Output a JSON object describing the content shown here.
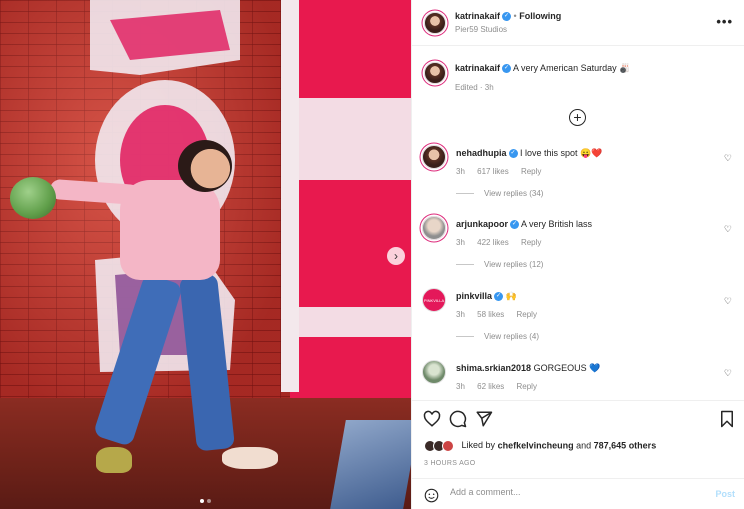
{
  "post": {
    "header": {
      "username": "katrinakaif",
      "separator": "•",
      "follow_label": "Following",
      "location": "Pier59 Studios",
      "more_label": "•••"
    },
    "caption": {
      "username": "katrinakaif",
      "text": "A very American Saturday 🎳",
      "meta": "Edited · 3h"
    },
    "load_more_label": "+",
    "next_label": "›",
    "carousel": {
      "count": 2,
      "active_index": 0
    }
  },
  "comments": [
    {
      "username": "nehadhupia",
      "verified": true,
      "text": "I love this spot 😛❤️",
      "time": "3h",
      "likes": "617 likes",
      "reply": "Reply",
      "replies": "View replies (34)"
    },
    {
      "username": "arjunkapoor",
      "verified": true,
      "text": "A very British lass",
      "time": "3h",
      "likes": "422 likes",
      "reply": "Reply",
      "replies": "View replies (12)"
    },
    {
      "username": "pinkvilla",
      "verified": true,
      "text": "🙌",
      "time": "3h",
      "likes": "58 likes",
      "reply": "Reply",
      "replies": "View replies (4)",
      "avatar_text": "PINKVILLA"
    },
    {
      "username": "shima.srkian2018",
      "verified": false,
      "text": "GORGEOUS 💙",
      "time": "3h",
      "likes": "62 likes",
      "reply": "Reply",
      "replies": ""
    }
  ],
  "actions": {
    "like_icon": "heart-icon",
    "comment_icon": "comment-icon",
    "share_icon": "share-icon",
    "save_icon": "bookmark-icon"
  },
  "likes": {
    "prefix": "Liked by",
    "user": "chefkelvincheung",
    "middle": "and",
    "others": "787,645 others"
  },
  "timestamp": "3 HOURS AGO",
  "add_comment": {
    "placeholder": "Add a comment...",
    "post_label": "Post"
  },
  "colors": {
    "verified": "#3897f0",
    "post_disabled": "#b2dffc",
    "text": "#262626",
    "muted": "#8e8e8e"
  }
}
